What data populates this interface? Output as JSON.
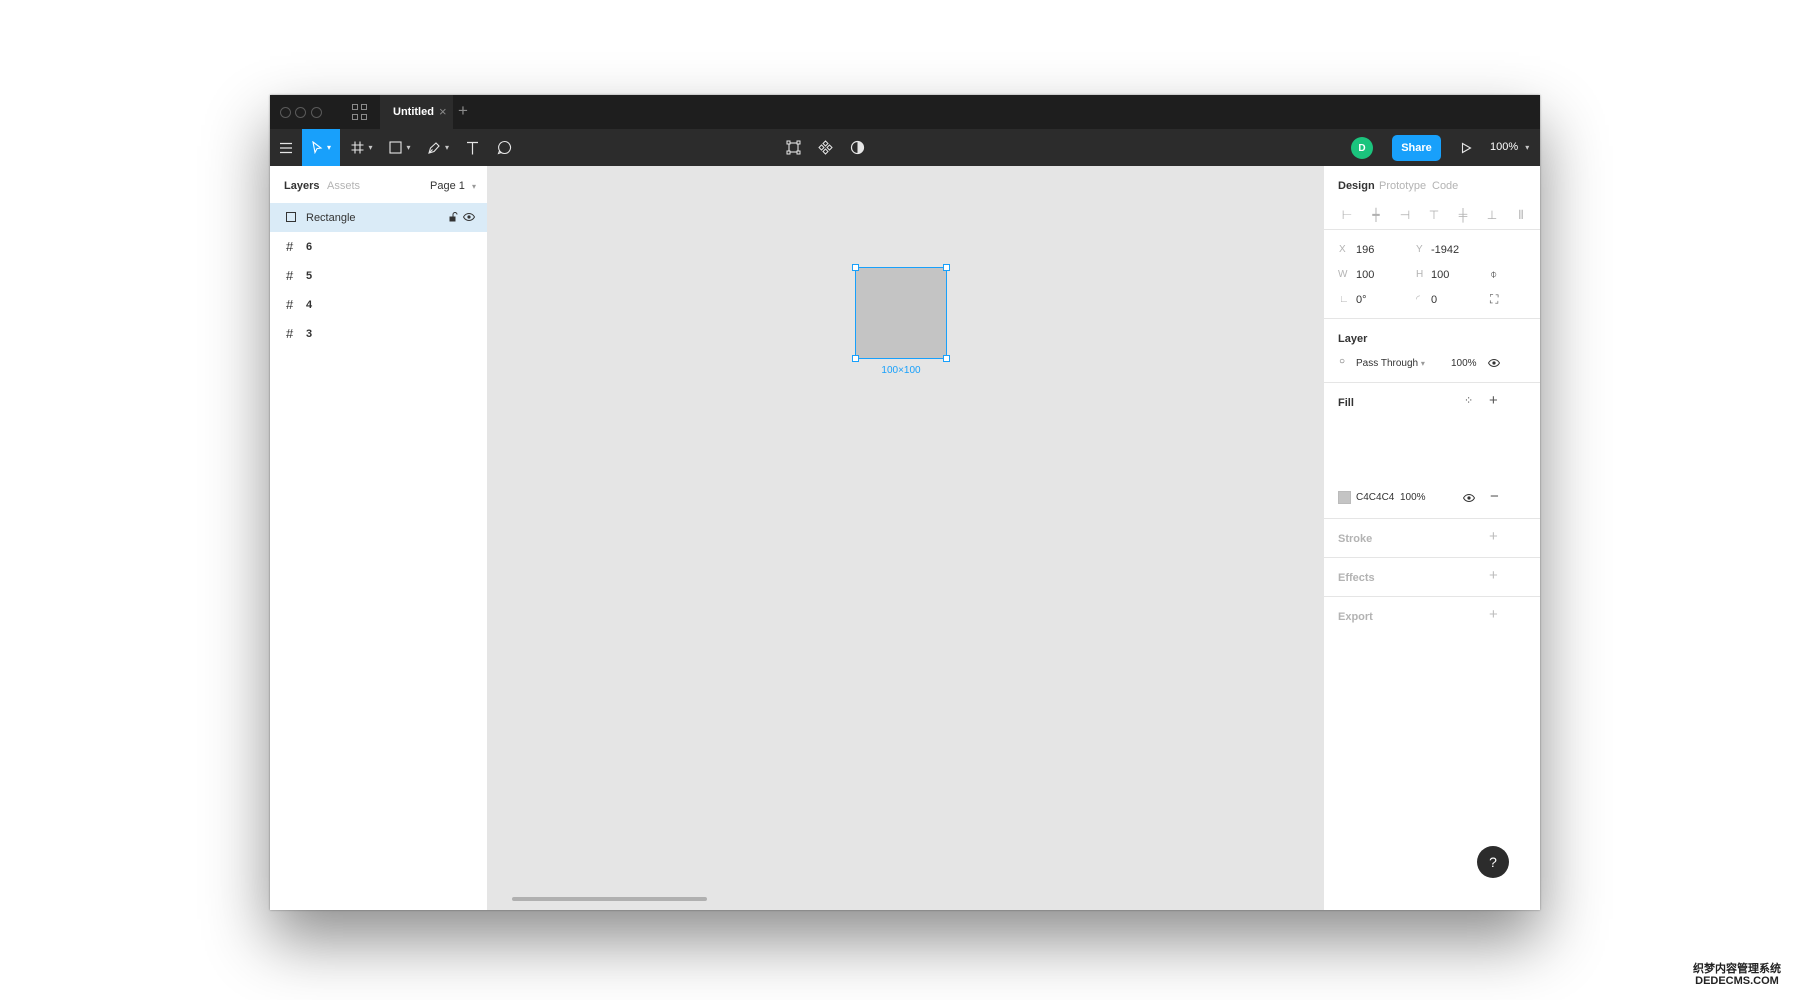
{
  "title_bar": {
    "tab_title": "Untitled",
    "tab_close": "×",
    "add_tab": "+"
  },
  "toolbar": {
    "zoom_level": "100%",
    "share_label": "Share",
    "user_initial": "D",
    "accent_color": "#18a0fb",
    "avatar_color": "#1bc47d"
  },
  "left_panel": {
    "tabs": [
      "Layers",
      "Assets"
    ],
    "page_selector": "Page 1",
    "layers": [
      {
        "icon": "rectangle-icon",
        "label": "Rectangle",
        "selected": true
      },
      {
        "icon": "frame-icon",
        "label": "6"
      },
      {
        "icon": "frame-icon",
        "label": "5"
      },
      {
        "icon": "frame-icon",
        "label": "4"
      },
      {
        "icon": "frame-icon",
        "label": "3"
      }
    ]
  },
  "canvas": {
    "selection_label": "100×100",
    "rect_fill": "#c4c4c4",
    "background": "#e5e5e5"
  },
  "right_panel": {
    "tabs": [
      "Design",
      "Prototype",
      "Code"
    ],
    "properties": {
      "x_label": "X",
      "x": "196",
      "y_label": "Y",
      "y": "-1942",
      "w_label": "W",
      "w": "100",
      "h_label": "H",
      "h": "100",
      "rotation": "0°",
      "radius": "0"
    },
    "layer": {
      "title": "Layer",
      "blend_mode": "Pass Through",
      "opacity": "100%"
    },
    "fill": {
      "title": "Fill",
      "hex": "C4C4C4",
      "opacity": "100%",
      "color": "#c4c4c4"
    },
    "stroke_title": "Stroke",
    "effects_title": "Effects",
    "export_title": "Export",
    "help": "?"
  },
  "watermark": {
    "line1": "织梦内容管理系统",
    "line2": "DEDECMS.COM"
  }
}
